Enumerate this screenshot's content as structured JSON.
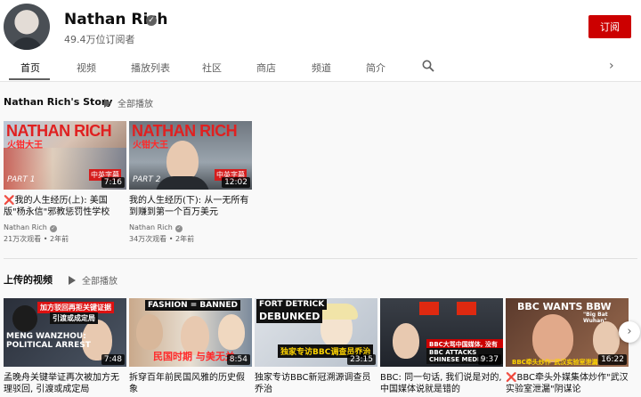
{
  "channel": {
    "name": "Nathan Rich",
    "subscribers": "49.4万位订阅者",
    "subscribe_label": "订阅"
  },
  "tabs": [
    {
      "label": "首页",
      "active": true
    },
    {
      "label": "视频"
    },
    {
      "label": "播放列表"
    },
    {
      "label": "社区"
    },
    {
      "label": "商店"
    },
    {
      "label": "频道"
    },
    {
      "label": "简介"
    }
  ],
  "sections": {
    "story": {
      "title": "Nathan Rich's Story",
      "play_all": "全部播放",
      "videos": [
        {
          "title": "我的人生经历(上): 美国版\"杨永信\"邪教惩罚性学校",
          "flag": "❌",
          "channel": "Nathan Rich",
          "views": "21万次观看",
          "age": "2年前",
          "duration": "7:16",
          "thumb_headline": "NATHAN RICH",
          "thumb_sub": "火钳大王",
          "thumb_badge": "中英字幕",
          "thumb_part": "PART 1"
        },
        {
          "title": "我的人生经历(下): 从一无所有到赚到第一个百万美元",
          "flag": "",
          "channel": "Nathan Rich",
          "views": "34万次观看",
          "age": "2年前",
          "duration": "12:02",
          "thumb_headline": "NATHAN RICH",
          "thumb_sub": "火钳大王",
          "thumb_badge": "中英字幕",
          "thumb_part": "PART 2"
        }
      ]
    },
    "uploads": {
      "title": "上传的视频",
      "play_all": "全部播放",
      "videos": [
        {
          "title": "孟晚舟关键举证再次被加方无理驳回, 引渡或成定局",
          "duration": "7:48",
          "thumb_text_1": "MENG WANZHOU:",
          "thumb_text_2": "POLITICAL ARREST",
          "thumb_badge": "加方驳回再拒关键证据",
          "thumb_badge_2": "引渡或成定局"
        },
        {
          "title": "拆穿百年前民国风雅的历史假象",
          "duration": "8:54",
          "thumb_text_1": "FASHION = BANNED",
          "thumb_text_2": "民国时期 与美无关"
        },
        {
          "title": "独家专访BBC新冠溯源调查员乔治",
          "duration": "23:15",
          "thumb_text_1": "FORT DETRICK",
          "thumb_text_2": "DEBUNKED",
          "thumb_badge": "独家专访BBC调查员乔治"
        },
        {
          "title": "BBC: 同一句话, 我们说是对的, 中国媒体说就是错的",
          "duration": "9:37",
          "thumb_text_1": "BBC大骂中国媒体, 没有眼",
          "thumb_text_2": "BBC ATTACKS CHINESE MEDIA"
        },
        {
          "title": "BBC牵头外媒集体炒作\"武汉实验室泄漏\"阴谋论",
          "flag": "❌",
          "duration": "16:22",
          "thumb_text_1": "BBC WANTS BBW",
          "thumb_text_2": "\"Big Bat Wuhan\"",
          "thumb_badge": "BBC牵头炒作\"武汉实验室泄漏\""
        }
      ]
    }
  },
  "colors": {
    "subscribe": "#cc0000",
    "thumb_red": "#e02020"
  },
  "icons": [
    "verified-icon",
    "search-icon",
    "chevron-right-icon",
    "play-icon"
  ]
}
